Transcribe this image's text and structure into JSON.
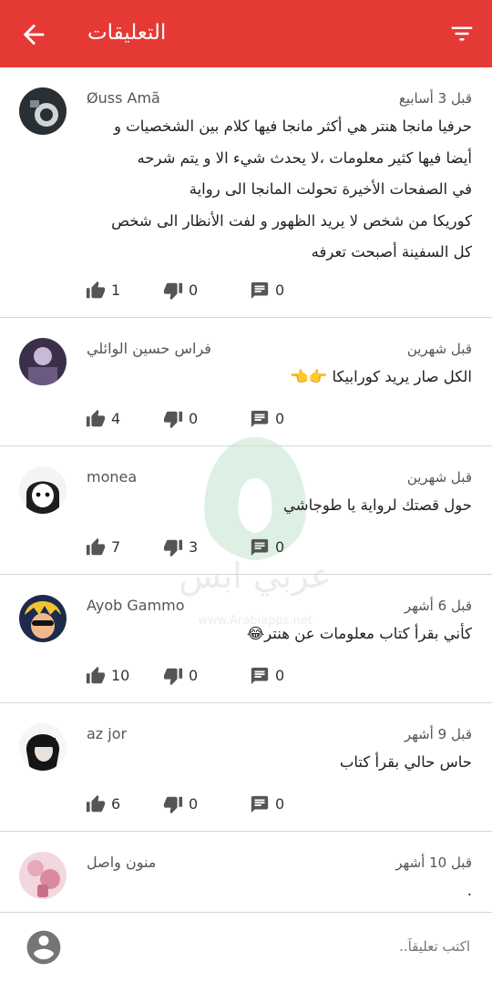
{
  "header": {
    "title": "التعليقات",
    "back_icon": "arrow-back-icon",
    "filter_icon": "filter-icon",
    "bar_color": "#e53935"
  },
  "comments": [
    {
      "author": "Øuss Amã",
      "time": "قبل 3 أسابيع",
      "lines": [
        "حرفيا مانجا هنتر هي أكثر مانجا فيها كلام بين الشخصيات و",
        "أيضا فيها كثير معلومات ،لا يحدث شيء الا و يتم شرحه",
        "في الصفحات الأخيرة تحولت المانجا الى رواية",
        "كوريكا من شخص لا يريد الظهور و لفت الأنظار الى شخص",
        "كل السفينة أصبحت تعرفه"
      ],
      "likes": "1",
      "dislikes": "0",
      "replies": "0"
    },
    {
      "author": "فراس حسين الوائلي",
      "time": "قبل شهرين",
      "lines": [
        "الكل صار يريد كورابيكا 👉👈"
      ],
      "likes": "4",
      "dislikes": "0",
      "replies": "0"
    },
    {
      "author": "monea",
      "time": "قبل شهرين",
      "lines": [
        "حول قصتك لرواية يا طوجاشي"
      ],
      "likes": "7",
      "dislikes": "3",
      "replies": "0"
    },
    {
      "author": "Ayob Gammo",
      "time": "قبل 6 أشهر",
      "lines": [
        "كأني بقرأ كتاب معلومات عن هنتر😂"
      ],
      "likes": "10",
      "dislikes": "0",
      "replies": "0"
    },
    {
      "author": "az jor",
      "time": "قبل 9 أشهر",
      "lines": [
        "حاس حالي بقرأ كتاب"
      ],
      "likes": "6",
      "dislikes": "0",
      "replies": "0"
    },
    {
      "author": "منون واصل",
      "time": "قبل 10 أشهر",
      "lines": [
        "."
      ]
    }
  ],
  "composer": {
    "placeholder": "اكتب تعليقاً..",
    "avatar_icon": "user-avatar-icon"
  },
  "watermark": {
    "brand": "عربي ابس",
    "url": "www.Arabiapps.net"
  }
}
